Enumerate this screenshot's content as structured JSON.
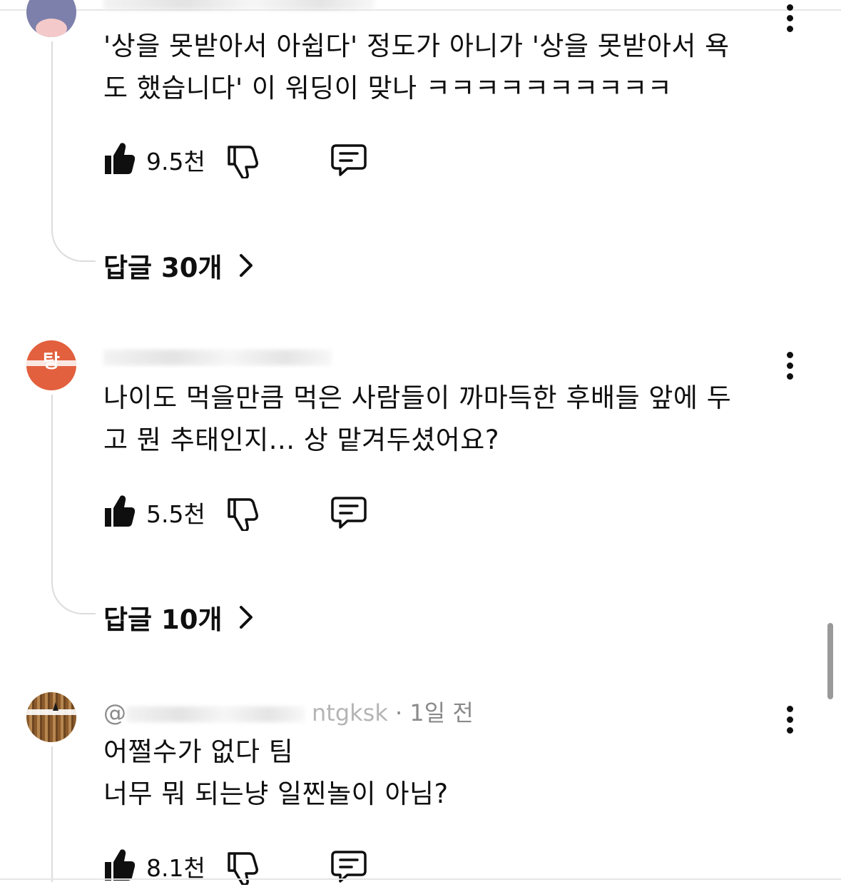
{
  "comments": [
    {
      "meta_name": "",
      "meta_time": "",
      "text": "'상을 못받아서 아쉽다' 정도가 아니가 '상을 못받아서 욕\n도 했습니다' 이 워딩이 맞나 ㅋㅋㅋㅋㅋㅋㅋㅋㅋㅋ",
      "likes": "9.5천",
      "replies_label": "답글 30개"
    },
    {
      "meta_name": "",
      "meta_time": "",
      "avatar_text": "탕",
      "text": "나이도 먹을만큼 먹은 사람들이 까마득한 후배들 앞에 두\n고 뭔 추태인지... 상 맡겨두셨어요?",
      "likes": "5.5천",
      "replies_label": "답글 10개"
    },
    {
      "meta_name": "@",
      "meta_handle_tail": "ntgksk",
      "meta_sep": "·",
      "meta_time": "1일 전",
      "text": "어쩔수가 없다 팀\n너무 뭐 되는냥 일찐놀이 아님?",
      "likes": "8.1천"
    }
  ],
  "colors": {
    "text": "#0f0f0f",
    "meta": "#8a8a8a",
    "avatar1": "#7d80ab",
    "avatar2": "#e2603e",
    "thread_line": "#dcdcdc"
  },
  "icons": {
    "like": "thumbs-up-icon",
    "dislike": "thumbs-down-icon",
    "reply": "comment-bubble-icon",
    "more": "more-vertical-icon",
    "chevron": "chevron-right-icon"
  }
}
